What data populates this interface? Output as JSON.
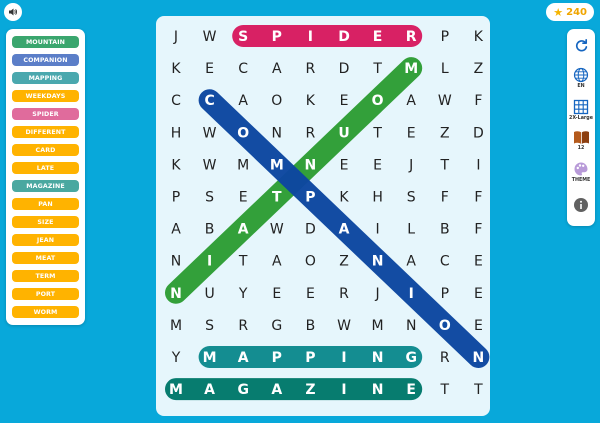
{
  "header": {
    "coins": "240"
  },
  "word_list": [
    {
      "label": "MOUNTAIN",
      "color": "#3aa66e"
    },
    {
      "label": "COMPANION",
      "color": "#5b7ec8"
    },
    {
      "label": "MAPPING",
      "color": "#4aa8ae"
    },
    {
      "label": "WEEKDAYS",
      "color": "#ffb300"
    },
    {
      "label": "SPIDER",
      "color": "#e06b9c"
    },
    {
      "label": "DIFFERENT",
      "color": "#ffb300"
    },
    {
      "label": "CARD",
      "color": "#ffb300"
    },
    {
      "label": "LATE",
      "color": "#ffb300"
    },
    {
      "label": "MAGAZINE",
      "color": "#4aa8a0"
    },
    {
      "label": "PAN",
      "color": "#ffb300"
    },
    {
      "label": "SIZE",
      "color": "#ffb300"
    },
    {
      "label": "JEAN",
      "color": "#ffb300"
    },
    {
      "label": "MEAT",
      "color": "#ffb300"
    },
    {
      "label": "TERM",
      "color": "#ffb300"
    },
    {
      "label": "PORT",
      "color": "#ffb300"
    },
    {
      "label": "WORM",
      "color": "#ffb300"
    }
  ],
  "grid": [
    [
      "J",
      "W",
      "S",
      "P",
      "I",
      "D",
      "E",
      "R",
      "P",
      "K"
    ],
    [
      "K",
      "E",
      "C",
      "A",
      "R",
      "D",
      "T",
      "M",
      "L",
      "Z"
    ],
    [
      "C",
      "C",
      "A",
      "O",
      "K",
      "E",
      "O",
      "A",
      "W",
      "F"
    ],
    [
      "H",
      "W",
      "O",
      "N",
      "R",
      "U",
      "T",
      "E",
      "Z",
      "D"
    ],
    [
      "K",
      "W",
      "M",
      "M",
      "N",
      "E",
      "E",
      "J",
      "T",
      "I"
    ],
    [
      "P",
      "S",
      "E",
      "T",
      "P",
      "K",
      "H",
      "S",
      "F",
      "F"
    ],
    [
      "A",
      "B",
      "A",
      "W",
      "D",
      "A",
      "I",
      "L",
      "B",
      "F"
    ],
    [
      "N",
      "I",
      "T",
      "A",
      "O",
      "Z",
      "N",
      "A",
      "C",
      "E"
    ],
    [
      "N",
      "U",
      "Y",
      "E",
      "E",
      "R",
      "J",
      "I",
      "P",
      "E"
    ],
    [
      "M",
      "S",
      "R",
      "G",
      "B",
      "W",
      "M",
      "N",
      "O",
      "E"
    ],
    [
      "Y",
      "M",
      "A",
      "P",
      "P",
      "I",
      "N",
      "G",
      "R",
      "N"
    ],
    [
      "M",
      "A",
      "G",
      "A",
      "Z",
      "I",
      "N",
      "E",
      "T",
      "T"
    ]
  ],
  "found_words": [
    {
      "word": "SPIDER",
      "color": "#d81b60",
      "start": [
        0,
        2
      ],
      "end": [
        0,
        7
      ]
    },
    {
      "word": "MOUNTAIN",
      "color": "#2e9e34",
      "start": [
        1,
        7
      ],
      "end": [
        8,
        0
      ]
    },
    {
      "word": "COMPANION",
      "color": "#0d47a1",
      "start": [
        2,
        1
      ],
      "end": [
        10,
        9
      ]
    },
    {
      "word": "MAPPING",
      "color": "#0e8a8e",
      "start": [
        10,
        1
      ],
      "end": [
        10,
        7
      ]
    },
    {
      "word": "MAGAZINE",
      "color": "#00796b",
      "start": [
        11,
        0
      ],
      "end": [
        11,
        7
      ]
    }
  ],
  "side_menu": [
    {
      "icon": "refresh-icon",
      "label": ""
    },
    {
      "icon": "globe-icon",
      "label": "EN"
    },
    {
      "icon": "grid-icon",
      "label": "2X-Large"
    },
    {
      "icon": "book-icon",
      "label": "12"
    },
    {
      "icon": "palette-icon",
      "label": "THEME"
    },
    {
      "icon": "info-icon",
      "label": ""
    }
  ]
}
